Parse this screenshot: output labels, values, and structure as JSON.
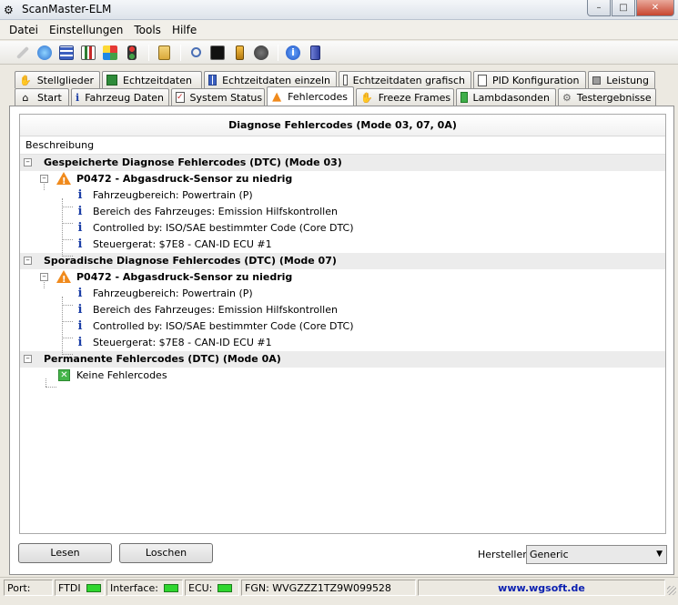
{
  "window": {
    "title": "ScanMaster-ELM"
  },
  "menu": {
    "items": [
      "Datei",
      "Einstellungen",
      "Tools",
      "Hilfe"
    ]
  },
  "toolbar": {
    "buttons": [
      "wrench-icon",
      "globe-icon",
      "grid-icon",
      "chart-icon",
      "flag-icon",
      "traffic-light-icon",
      "clipboard-icon",
      "search-icon",
      "terminal-icon",
      "battery-icon",
      "gauge-icon",
      "info-icon",
      "exit-icon"
    ]
  },
  "tabs": {
    "row1": [
      {
        "label": "Stellglieder",
        "icon": "hand-icon"
      },
      {
        "label": "Echtzeitdaten",
        "icon": "list-icon"
      },
      {
        "label": "Echtzeitdaten einzeln",
        "icon": "table-icon"
      },
      {
        "label": "Echtzeitdaten grafisch",
        "icon": "chart-icon"
      },
      {
        "label": "PID Konfiguration",
        "icon": "document-icon"
      },
      {
        "label": "Leistung",
        "icon": "engine-icon"
      }
    ],
    "row2": [
      {
        "label": "Start",
        "icon": "home-icon"
      },
      {
        "label": "Fahrzeug Daten",
        "icon": "info-icon"
      },
      {
        "label": "System Status",
        "icon": "checklist-icon"
      },
      {
        "label": "Fehlercodes",
        "icon": "warning-icon",
        "active": true
      },
      {
        "label": "Freeze Frames",
        "icon": "hand-icon"
      },
      {
        "label": "Lambdasonden",
        "icon": "sensor-icon"
      },
      {
        "label": "Testergebnisse",
        "icon": "gear-icon"
      }
    ]
  },
  "tree": {
    "header": "Diagnose Fehlercodes (Mode 03, 07, 0A)",
    "column": "Beschreibung",
    "groups": [
      {
        "title": "Gespeicherte Diagnose Fehlercodes (DTC) (Mode 03)",
        "code": "P0472 - Abgasdruck-Sensor zu niedrig",
        "details": [
          "Fahrzeugbereich: Powertrain (P)",
          "Bereich des Fahrzeuges: Emission Hilfskontrollen",
          "Controlled by: ISO/SAE bestimmter Code (Core DTC)",
          "Steuergerat: $7E8 - CAN-ID ECU #1"
        ]
      },
      {
        "title": "Sporadische Diagnose Fehlercodes (DTC) (Mode 07)",
        "code": "P0472 - Abgasdruck-Sensor zu niedrig",
        "details": [
          "Fahrzeugbereich: Powertrain (P)",
          "Bereich des Fahrzeuges: Emission Hilfskontrollen",
          "Controlled by: ISO/SAE bestimmter Code (Core DTC)",
          "Steuergerat: $7E8 - CAN-ID ECU #1"
        ]
      },
      {
        "title": "Permanente Fehlercodes (DTC) (Mode 0A)",
        "none": "Keine Fehlercodes"
      }
    ]
  },
  "buttons": {
    "read": "Lesen",
    "clear": "Loschen"
  },
  "manufacturer": {
    "label": "Hersteller",
    "value": "Generic"
  },
  "status": {
    "port_label": "Port:",
    "ftdi_label": "FTDI",
    "interface_label": "Interface:",
    "ecu_label": "ECU:",
    "fgn": "FGN: WVGZZZ1TZ9W099528",
    "url": "www.wgsoft.de"
  },
  "colors": {
    "led": "#2fd62f",
    "url": "#0a1fb0",
    "warning": "#f08a1c",
    "info": "#1b3ea6"
  }
}
